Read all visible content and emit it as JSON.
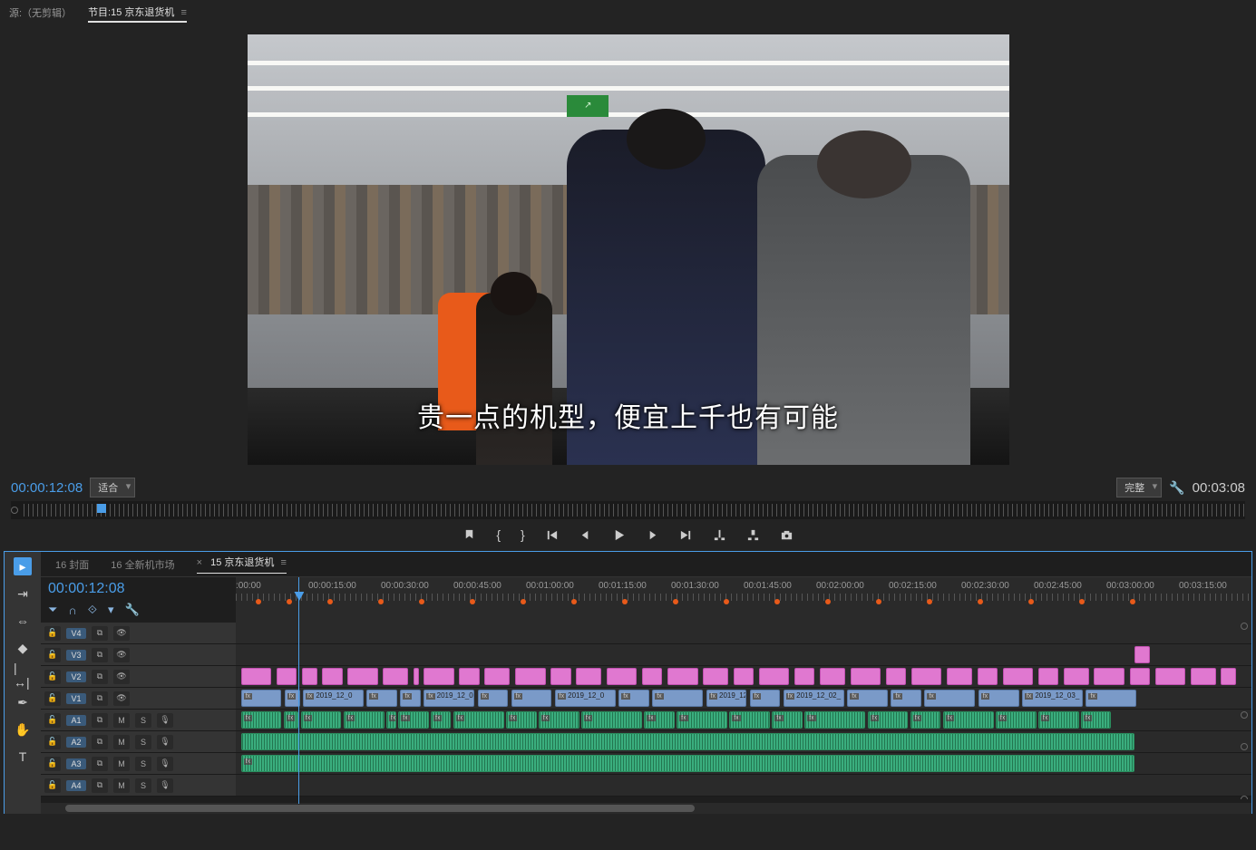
{
  "tabs": {
    "source": "源:（无剪辑）",
    "program_prefix": "节目:",
    "program_name": "15 京东退货机"
  },
  "subtitle": "贵一点的机型，便宜上千也有可能",
  "monitor": {
    "timecode": "00:00:12:08",
    "fit": "适合",
    "quality": "完整",
    "duration": "00:03:08"
  },
  "transport": [
    "marker",
    "in",
    "out",
    "goto-in",
    "step-back",
    "play",
    "step-fwd",
    "goto-out",
    "lift",
    "extract",
    "snapshot"
  ],
  "seq_tabs": [
    {
      "label": "16 封面"
    },
    {
      "label": "16 全新机市场"
    },
    {
      "label": "15 京东退货机",
      "active": true
    }
  ],
  "timeline": {
    "timecode": "00:00:12:08",
    "time_labels": [
      ":00:00",
      "00:00:15:00",
      "00:00:30:00",
      "00:00:45:00",
      "00:01:00:00",
      "00:01:15:00",
      "00:01:30:00",
      "00:01:45:00",
      "00:02:00:00",
      "00:02:15:00",
      "00:02:30:00",
      "00:02:45:00",
      "00:03:00:00",
      "00:03:15:00"
    ],
    "video_tracks": [
      {
        "id": "V4"
      },
      {
        "id": "V3"
      },
      {
        "id": "V2"
      },
      {
        "id": "V1"
      }
    ],
    "audio_tracks": [
      {
        "id": "A1"
      },
      {
        "id": "A2"
      },
      {
        "id": "A3"
      },
      {
        "id": "A4"
      }
    ],
    "clip_labels": {
      "date1": "2019_12_02_",
      "date2": "2019_12_0",
      "date3": "2019_12_03_",
      "fx": "fx"
    }
  },
  "track_buttons": {
    "lock": "🔒",
    "sync": "⧉",
    "mute": "M",
    "solo": "S",
    "eye": "👁",
    "mic": "🎤"
  }
}
